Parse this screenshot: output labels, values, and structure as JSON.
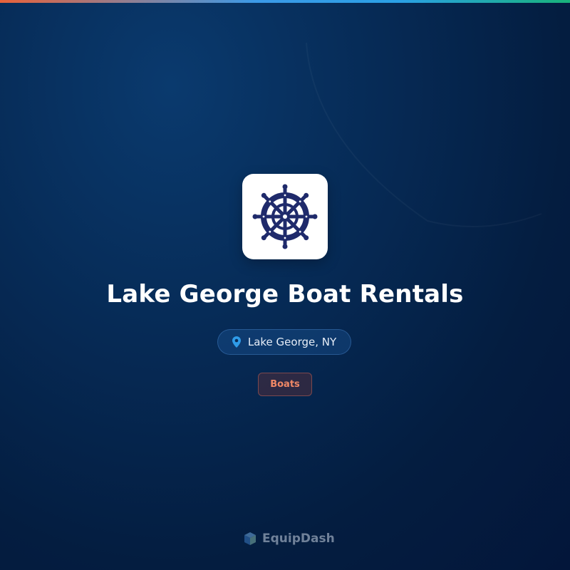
{
  "business": {
    "name": "Lake George Boat Rentals",
    "location": "Lake George, NY",
    "category": "Boats"
  },
  "branding": {
    "footer_name": "EquipDash"
  },
  "icons": {
    "logo": "ship-wheel-icon",
    "location": "map-pin-icon",
    "brand": "equipdash-logo-icon"
  },
  "colors": {
    "background": "#041d40",
    "logo_tile": "#ffffff",
    "wheel": "#1f2a6b",
    "location_pin": "#2f9be8",
    "category_text": "#f08866"
  }
}
